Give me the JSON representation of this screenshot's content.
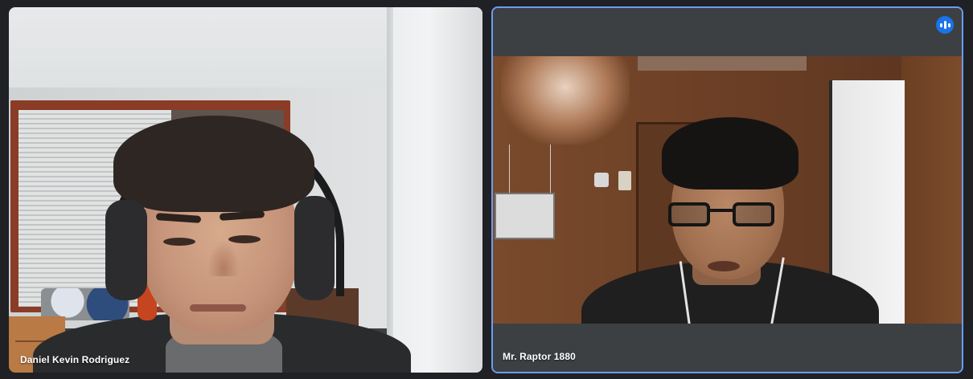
{
  "meeting": {
    "participants": [
      {
        "name": "Daniel Kevin Rodriguez",
        "speaking": false
      },
      {
        "name": "Mr. Raptor 1880",
        "speaking": true
      }
    ],
    "active_speaker_color": "#6b9cf3",
    "speaking_indicator_icon": "audio-level-icon"
  }
}
